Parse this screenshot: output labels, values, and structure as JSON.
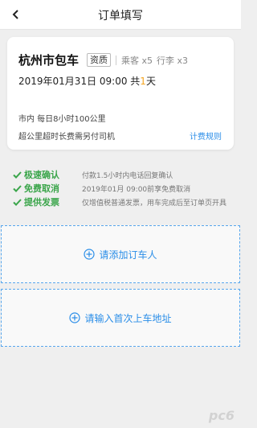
{
  "nav": {
    "title": "订单填写"
  },
  "order": {
    "product": "杭州市包车",
    "badge": "资质",
    "passengers": "乘客 x5",
    "luggage": "行李 x3",
    "datetime": "2019年01月31日 09:00 共",
    "days": "1",
    "days_unit": "天",
    "service_scope": "市内 每日8小时100公里",
    "overtime_note": "超公里超时长费需另付司机",
    "fee_rules_link": "计费规则"
  },
  "features": [
    {
      "name": "极速确认",
      "desc": "付款1.5小时内电话回复确认"
    },
    {
      "name": "免费取消",
      "desc": "2019年01月 09:00前享免费取消"
    },
    {
      "name": "提供发票",
      "desc": "仅增值税普通发票，用车完成后至订单页开具"
    }
  ],
  "actions": {
    "add_orderer": "请添加订车人",
    "add_pickup_address": "请输入首次上车地址"
  },
  "colors": {
    "accent": "#2b8ee8",
    "success": "#3aa54a",
    "highlight": "#f5a623"
  },
  "watermark": "pc6"
}
